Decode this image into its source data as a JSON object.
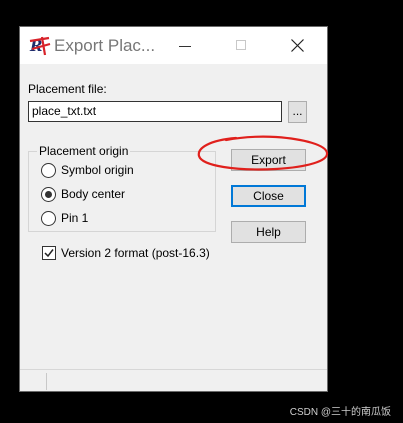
{
  "window": {
    "title": "Export Plac..."
  },
  "placement_file": {
    "label": "Placement file:",
    "value": "place_txt.txt",
    "browse_label": "..."
  },
  "placement_origin": {
    "title": "Placement origin",
    "options": [
      {
        "label": "Symbol origin",
        "selected": false
      },
      {
        "label": "Body center",
        "selected": true
      },
      {
        "label": "Pin 1",
        "selected": false
      }
    ]
  },
  "version_checkbox": {
    "label": "Version 2 format (post-16.3)",
    "checked": true
  },
  "buttons": {
    "export": "Export",
    "close": "Close",
    "help": "Help"
  },
  "annotation": {
    "color": "#e0201c"
  },
  "watermark": "CSDN @三十的南瓜饭",
  "icons": [
    "app-logo-icon",
    "minimize-icon",
    "maximize-icon",
    "close-icon",
    "checkmark-icon"
  ]
}
